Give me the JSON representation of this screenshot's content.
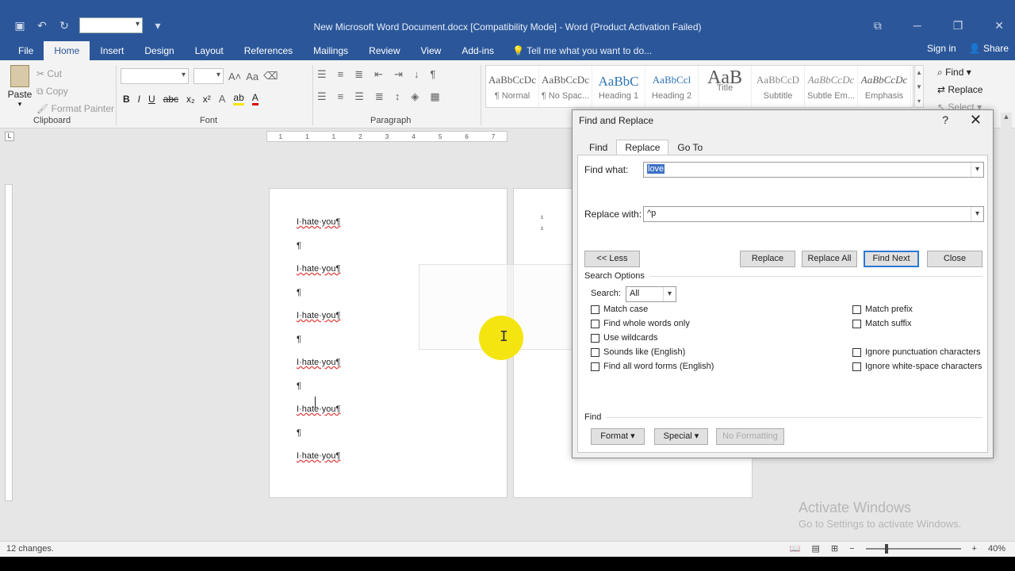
{
  "window": {
    "title": "New Microsoft Word Document.docx [Compatibility Mode] - Word (Product Activation Failed)"
  },
  "ribbon_tabs": [
    "File",
    "Home",
    "Insert",
    "Design",
    "Layout",
    "References",
    "Mailings",
    "Review",
    "View",
    "Add-ins"
  ],
  "tell_me": "Tell me what you want to do...",
  "account": {
    "sign_in": "Sign in",
    "share": "Share"
  },
  "clipboard": {
    "paste": "Paste",
    "cut": "Cut",
    "copy": "Copy",
    "format_painter": "Format Painter",
    "label": "Clipboard"
  },
  "font_group": {
    "label": "Font",
    "bold": "B",
    "italic": "I",
    "underline": "U",
    "strike": "abc",
    "sub": "x₂",
    "sup": "x²",
    "grow": "A˄",
    "shrink": "Aa",
    "color": "A"
  },
  "paragraph_group": {
    "label": "Paragraph"
  },
  "styles": [
    {
      "sample": "AaBbCcDc",
      "name": "¶ Normal"
    },
    {
      "sample": "AaBbCcDc",
      "name": "¶ No Spac..."
    },
    {
      "sample": "AaBbC",
      "name": "Heading 1"
    },
    {
      "sample": "AaBbCcl",
      "name": "Heading 2"
    },
    {
      "sample": "AaB",
      "name": "Title"
    },
    {
      "sample": "AaBbCcD",
      "name": "Subtitle"
    },
    {
      "sample": "AaBbCcDc",
      "name": "Subtle Em..."
    },
    {
      "sample": "AaBbCcDc",
      "name": "Emphasis"
    }
  ],
  "editing": {
    "find": "Find",
    "replace": "Replace",
    "select": "Select"
  },
  "ruler": [
    "1",
    "1",
    "1",
    "2",
    "3",
    "4",
    "5",
    "6",
    "7"
  ],
  "document_lines": [
    "I·hate·you¶",
    "¶",
    "I·hate·you¶",
    "¶",
    "I·hate·you¶",
    "¶",
    "I·hate·you¶",
    "¶",
    "I·hate·you¶",
    "¶",
    "I·hate·you¶"
  ],
  "page2_marks": [
    "¹",
    "¹"
  ],
  "dialog": {
    "title": "Find and Replace",
    "help": "?",
    "close": "✕",
    "tabs": [
      "Find",
      "Replace",
      "Go To"
    ],
    "find_label": "Find what:",
    "find_value": "love",
    "replace_label": "Replace with:",
    "replace_value": "^p",
    "buttons": {
      "less": "<< Less",
      "replace": "Replace",
      "replace_all": "Replace All",
      "find_next": "Find Next",
      "close": "Close"
    },
    "search_options": "Search Options",
    "search_label": "Search:",
    "search_value": "All",
    "checks_left": [
      "Match case",
      "Find whole words only",
      "Use wildcards",
      "Sounds like (English)",
      "Find all word forms (English)"
    ],
    "checks_right": [
      "Match prefix",
      "Match suffix",
      "Ignore punctuation characters",
      "Ignore white-space characters"
    ],
    "find_section": "Find",
    "format": "Format ▾",
    "special": "Special ▾",
    "no_formatting": "No Formatting"
  },
  "watermark": {
    "line1": "Activate Windows",
    "line2": "Go to Settings to activate Windows."
  },
  "status": {
    "changes": "12 changes.",
    "zoom": "40%"
  }
}
